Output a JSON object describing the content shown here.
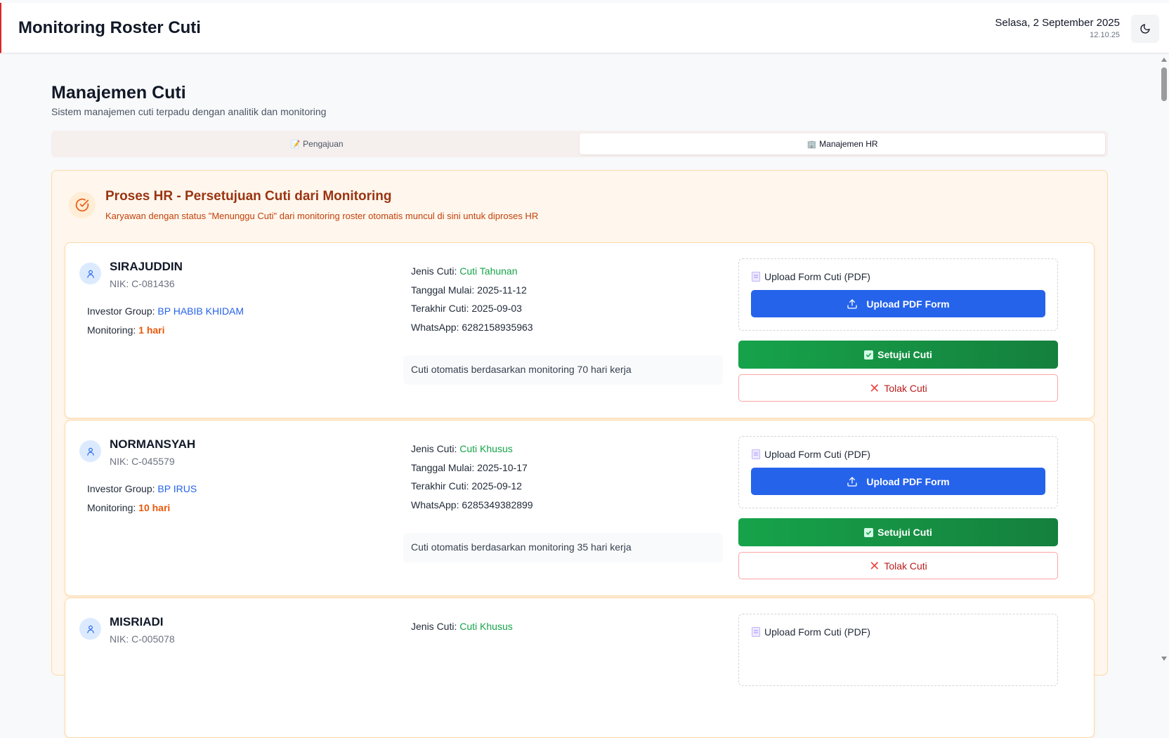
{
  "header": {
    "title": "Monitoring Roster Cuti",
    "date": "Selasa, 2 September 2025",
    "time": "12.10.25",
    "theme_icon": "moon-icon"
  },
  "page": {
    "title": "Manajemen Cuti",
    "subtitle": "Sistem manajemen cuti terpadu dengan analitik dan monitoring"
  },
  "tabs": [
    {
      "icon": "📝",
      "label": "Pengajuan",
      "active": false
    },
    {
      "icon": "🏢",
      "label": "Manajemen HR",
      "active": true
    }
  ],
  "panel": {
    "title": "Proses HR - Persetujuan Cuti dari Monitoring",
    "description": "Karyawan dengan status \"Menunggu Cuti\" dari monitoring roster otomatis muncul di sini untuk diproses HR"
  },
  "labels": {
    "investor_group": "Investor Group:",
    "monitoring": "Monitoring:",
    "jenis_cuti": "Jenis Cuti:",
    "tanggal_mulai": "Tanggal Mulai:",
    "terakhir_cuti": "Terakhir Cuti:",
    "whatsapp": "WhatsApp:",
    "upload_label": "Upload Form Cuti (PDF)",
    "upload_button": "Upload PDF Form",
    "approve_button": "Setujui Cuti",
    "reject_button": "Tolak Cuti"
  },
  "employees": [
    {
      "name": "SIRAJUDDIN",
      "nik": "NIK: C-081436",
      "investor_group": "BP HABIB KHIDAM",
      "monitoring": "1 hari",
      "jenis_cuti": "Cuti Tahunan",
      "tanggal_mulai": "2025-11-12",
      "terakhir_cuti": "2025-09-03",
      "whatsapp": "6282158935963",
      "note": "Cuti otomatis berdasarkan monitoring 70 hari kerja"
    },
    {
      "name": "NORMANSYAH",
      "nik": "NIK: C-045579",
      "investor_group": "BP IRUS",
      "monitoring": "10 hari",
      "jenis_cuti": "Cuti Khusus",
      "tanggal_mulai": "2025-10-17",
      "terakhir_cuti": "2025-09-12",
      "whatsapp": "6285349382899",
      "note": "Cuti otomatis berdasarkan monitoring 35 hari kerja"
    },
    {
      "name": "MISRIADI",
      "nik": "NIK: C-005078",
      "jenis_cuti": "Cuti Khusus"
    }
  ],
  "colors": {
    "accent_red": "#dc2626",
    "primary_blue": "#2563eb",
    "approve_green": "#16a34a",
    "reject_red": "#b91c1c",
    "panel_bg": "#fff7ed",
    "title_brown": "#9a3412"
  }
}
